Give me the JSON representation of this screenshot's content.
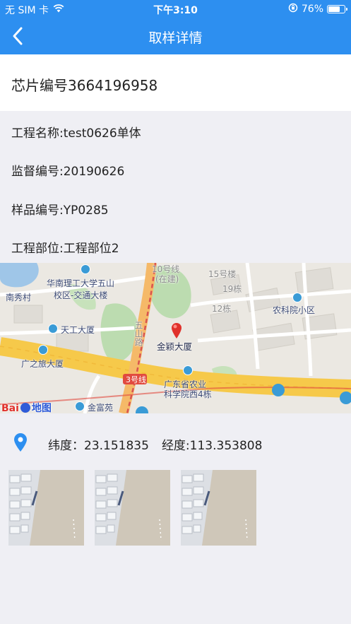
{
  "status_bar": {
    "carrier": "无 SIM 卡",
    "time": "下午3:10",
    "battery": "76%",
    "battery_level": 0.76
  },
  "nav": {
    "back_icon": "chevron-left-icon",
    "title": "取样详情"
  },
  "chip": {
    "label": "芯片编号3664196958"
  },
  "info": [
    {
      "label": "工程名称:test0626单体"
    },
    {
      "label": "监督编号:20190626"
    },
    {
      "label": "样品编号:YP0285"
    },
    {
      "label": "工程部位:工程部位2"
    }
  ],
  "map": {
    "labels": {
      "nanxiu": "南秀村",
      "huanan": "华南理工大学五山",
      "huanan2": "校区-交通大楼",
      "line10": "10号线",
      "line10b": "(在建)",
      "bld15": "15号楼",
      "bld19": "19栋",
      "bld12": "12栋",
      "nongke": "农科院小区",
      "tiangong": "天工大厦",
      "wushan": "五山路",
      "jinying": "金颖大厦",
      "guangzhilv": "广之旅大厦",
      "line3": "3号线",
      "guangdong1": "广东省农业",
      "guangdong2": "科学院西4栋",
      "jinfu": "金富苑",
      "baidu": "Bai",
      "baidu2": "地图"
    }
  },
  "location": {
    "icon": "location-pin-icon",
    "lat": "纬度：23.151835",
    "lng": "经度:113.353808"
  },
  "photos": [
    {
      "name": "sample-photo-1"
    },
    {
      "name": "sample-photo-2"
    },
    {
      "name": "sample-photo-3"
    }
  ]
}
